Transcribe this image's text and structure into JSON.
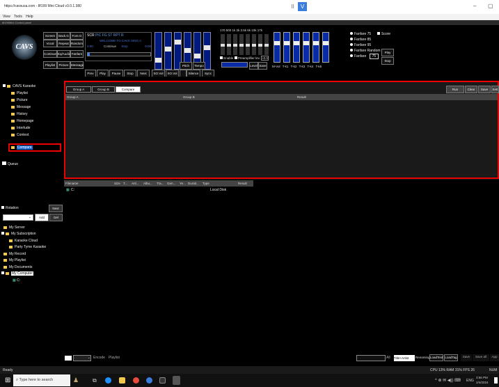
{
  "window": {
    "title": "https://cavsusa.com - 8f199 Mini Cloud v3.0.1.380"
  },
  "menu": [
    "View",
    "Tools",
    "Help"
  ],
  "panel_label": "8f199Mini Control panel",
  "logo": {
    "text": "CAVS"
  },
  "ctrl_buttons": {
    "row1": [
      "Screen",
      "Back.G",
      "Fore.G"
    ],
    "row2": [
      "Vocal",
      "Repeat",
      "Random"
    ],
    "row3": [
      "Continue",
      "Eq/Audio",
      "Fanfare"
    ],
    "row4": [
      "Playlist",
      "Picture",
      "Message"
    ]
  },
  "display": {
    "tabs": [
      "SCR",
      "PIC",
      "FG",
      "ST",
      "RPT",
      "R"
    ],
    "line1": "WELCOME TO CAVS SING A",
    "line2_left": "0:00",
    "line2_mid": "Continue",
    "line2_stop": "Stop",
    "line2_right": "0:00"
  },
  "transport": [
    "Prev",
    "Play",
    "Pause",
    "Stop",
    "Next",
    "SO.Vol",
    "SO.Vol"
  ],
  "mixer": {
    "pitch": "Pitch",
    "tempo": "Tempo",
    "silence": "Silence",
    "sync": "Sync"
  },
  "eq": {
    "freqs": "170 500 1k 2k 3.5k 6k 10k 17k",
    "enable": "Enable",
    "preamp": "Preamplifier lev.",
    "preamp_val": "+0.0",
    "level": "Level",
    "save": "Save",
    "bands": [
      "M-Vol",
      "T-k1",
      "T-k2",
      "T-k3",
      "T-k4",
      "T-k5"
    ]
  },
  "fanfare": {
    "options": [
      "Fanfare 75",
      "Fanfare 85",
      "Fanfare 95",
      "Fanfare Random",
      "Fanfare"
    ],
    "value": "75",
    "score": "Score",
    "play": "Play",
    "stop": "Stop"
  },
  "tree": {
    "root": "CAVS Karaoke",
    "items": [
      "Playlist",
      "Picture",
      "Message",
      "History",
      "Homepage",
      "Interlude",
      "Contest",
      "Compare"
    ]
  },
  "queue": "Queue",
  "rotation": {
    "label": "Rotation",
    "next": "Next",
    "add": "Add",
    "del": "Del"
  },
  "sources": [
    "My Server",
    "My Subscription",
    "Karaoke Cloud",
    "Party Tyme Karaoke",
    "My Record",
    "My Playlist",
    "My Documents",
    "My Computer",
    "C:"
  ],
  "compare": {
    "tabs": [
      "Group A",
      "Group B",
      "Compare"
    ],
    "cols": [
      "Group A",
      "Group B",
      "Result"
    ],
    "actions": [
      "Run",
      "Clear",
      "Save",
      "Sett"
    ]
  },
  "files": {
    "cols": [
      "Filename",
      "Size",
      "T...",
      "Arti...",
      "Albu...",
      "Tra...",
      "Gen...",
      "Ye...",
      "Durati...",
      "Type",
      "Result"
    ],
    "row": {
      "name": "C:",
      "type": "Local Disk"
    }
  },
  "bottom": {
    "encode": "Encode",
    "playlist": "Playlist",
    "title": "Title+Artist",
    "renaming": "Renaming",
    "loadtext": "LoadText",
    "loadtag": "LoadTag",
    "save": "Save",
    "saveall": "Save all",
    "app": "App",
    "all": "All"
  },
  "status": {
    "left": "Ready",
    "perf": "CPU 13% RAM 31% FPS 26",
    "num": "NUM"
  },
  "taskbar": {
    "search": "Type here to search",
    "time": "3:56 PM",
    "date": "2/4/2024",
    "lang": "ENG"
  }
}
